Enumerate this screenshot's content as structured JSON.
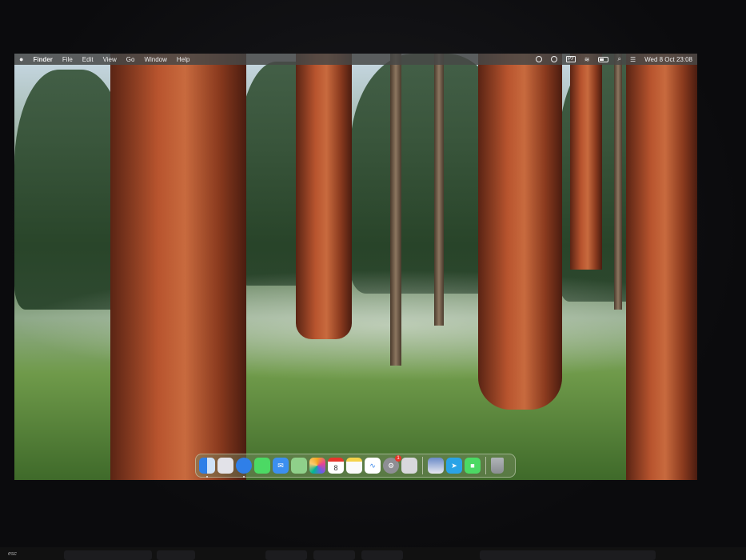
{
  "menubar": {
    "apple": "",
    "app_name": "Finder",
    "items": [
      "File",
      "Edit",
      "View",
      "Go",
      "Window",
      "Help"
    ],
    "keyboard_layout": "РУ",
    "datetime": "Wed 8 Oct  23:08"
  },
  "dock": {
    "apps": [
      {
        "name": "Finder",
        "color": "#3a8ff0"
      },
      {
        "name": "Launchpad",
        "color": "#d9d9e0"
      },
      {
        "name": "Safari",
        "color": "#2f7fe8"
      },
      {
        "name": "Messages",
        "color": "#4cd964"
      },
      {
        "name": "Mail",
        "color": "#3c8ff0"
      },
      {
        "name": "Maps",
        "color": "#6fc26b"
      },
      {
        "name": "Photos",
        "color": "#f0f0f0"
      },
      {
        "name": "Calendar",
        "color": "#ffffff"
      },
      {
        "name": "Notes",
        "color": "#f5e27a"
      },
      {
        "name": "Freeform",
        "color": "#ffffff"
      },
      {
        "name": "System Settings",
        "color": "#9a9aa0"
      },
      {
        "name": "iPhone Mirroring",
        "color": "#d8d8dc"
      }
    ],
    "calendar_day": "8",
    "settings_badge": "1",
    "extra": [
      {
        "name": "Preview",
        "color": "#c8d0e0"
      },
      {
        "name": "Telegram",
        "color": "#2aa3e6"
      },
      {
        "name": "FaceTime",
        "color": "#4cd964"
      }
    ],
    "trash": "Trash"
  },
  "keyboard": {
    "esc": "esc"
  }
}
